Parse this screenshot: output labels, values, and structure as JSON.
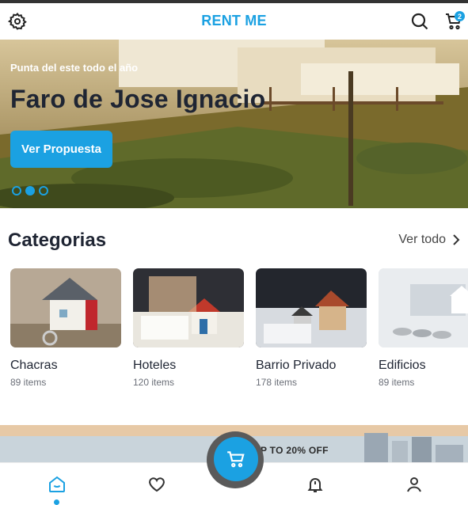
{
  "header": {
    "brand": "RENT ME",
    "cart_count": "2",
    "icons": [
      "gear-icon",
      "search-icon",
      "cart-icon"
    ]
  },
  "hero": {
    "kicker": "Punta del este todo el año",
    "title": "Faro de Jose Ignacio",
    "cta_label": "Ver Propuesta",
    "slides": 3,
    "active_slide": 2
  },
  "categories": {
    "title": "Categorias",
    "see_all_label": "Ver todo",
    "items": [
      {
        "name": "Chacras",
        "count": "89 items"
      },
      {
        "name": "Hoteles",
        "count": "120 items"
      },
      {
        "name": "Barrio Privado",
        "count": "178 items"
      },
      {
        "name": "Edificios",
        "count": "89 items"
      }
    ]
  },
  "promo": {
    "text": "UP TO 20% OFF"
  },
  "bottom_nav": {
    "items": [
      "home-icon",
      "heart-icon",
      "bell-icon",
      "user-icon"
    ],
    "active": "home-icon",
    "fab_icon": "cart-icon"
  },
  "colors": {
    "accent": "#1ba1e2",
    "text": "#1f2533",
    "muted": "#6b6f78"
  }
}
